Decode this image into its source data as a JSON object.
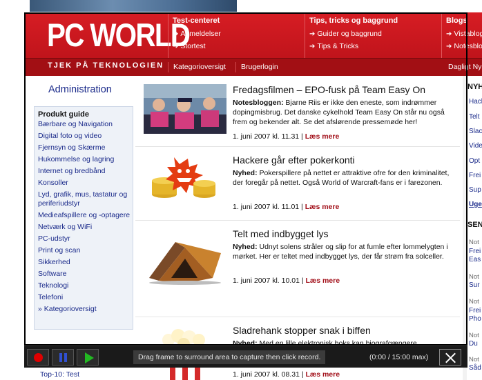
{
  "header": {
    "logo": "PC WORLD",
    "tagline": "TJEK PÅ TEKNOLOGIEN",
    "nav": [
      {
        "head": "Test-centeret",
        "links": [
          "Anmeldelser",
          "Stortest"
        ]
      },
      {
        "head": "Tips, tricks og baggrund",
        "links": [
          "Guider og baggrund",
          "Tips & Tricks"
        ]
      },
      {
        "head": "Blogs",
        "links": [
          "Vistablog",
          "Notesblog"
        ]
      }
    ],
    "sub_links": [
      "Kategorioversigt",
      "Brugerlogin"
    ],
    "sub_right": "Dagligt Ny"
  },
  "sidebar": {
    "admin": "Administration",
    "guide_title": "Produkt guide",
    "items": [
      "Bærbare og Navigation",
      "Digital foto og video",
      "Fjernsyn og Skærme",
      "Hukommelse og lagring",
      "Internet og bredbånd",
      "Konsoller",
      "Lyd, grafik, mus, tastatur og periferiudstyr",
      "Medieafspillere og -optagere",
      "Netværk og WiFi",
      "PC-udstyr",
      "Print og scan",
      "Sikkerhed",
      "Software",
      "Teknologi",
      "Telefoni",
      "» Kategorioversigt"
    ],
    "topten": "Top-10: Test"
  },
  "articles": [
    {
      "title": "Fredagsfilmen – EPO-fusk på Team Easy On",
      "label": "Notesbloggen:",
      "body": " Bjarne Riis er ikke den eneste, som indrømmer dopingmisbrug. Det danske cykelhold Team Easy On står nu også frem og bekender alt. Se det afslørende pressemøde her!",
      "date": "1. juni 2007 kl. 11.31",
      "more": "Læs mere"
    },
    {
      "title": "Hackere går efter pokerkonti",
      "label": "Nyhed:",
      "body": " Pokerspillere på nettet er attraktive ofre for den kriminalitet, der foregår på nettet. Også World of Warcraft-fans er i farezonen.",
      "date": "1. juni 2007 kl. 11.01",
      "more": "Læs mere"
    },
    {
      "title": "Telt med indbygget lys",
      "label": "Nyhed:",
      "body": " Udnyt solens stråler og slip for at fumle efter lommelygten i mørket. Her er teltet med indbygget lys, der får strøm fra solceller.",
      "date": "1. juni 2007 kl. 10.01",
      "more": "Læs mere"
    },
    {
      "title": "Sladrehank stopper snak i biffen",
      "label": "Nyhed:",
      "body": " Med en lille elektronisk boks kan biografgængere",
      "date": "1. juni 2007 kl. 08.31",
      "more": "Læs mere"
    }
  ],
  "right_col": {
    "heading1": "NYH",
    "links1": [
      "Hack",
      "Telt",
      "Slac",
      "Vide",
      "Opt",
      "Frei",
      "Sup",
      "Uge"
    ],
    "heading2": "SEN",
    "groups": [
      {
        "small": "Not",
        "links": [
          "Frei",
          "Eas"
        ]
      },
      {
        "small": "Not",
        "links": [
          "Sur"
        ]
      },
      {
        "small": "Not",
        "links": [
          "Frei",
          "Pho"
        ]
      },
      {
        "small": "Not",
        "links": [
          "Du"
        ]
      },
      {
        "small": "Not",
        "links": [
          "Såd"
        ]
      }
    ]
  },
  "recorder": {
    "hint": "Drag frame to surround area to capture then click record.",
    "timer": "(0:00 / 15:00 max)"
  },
  "colors": {
    "brand_red": "#c8161d",
    "link_blue": "#1a2a8a",
    "more_red": "#a2101a"
  }
}
